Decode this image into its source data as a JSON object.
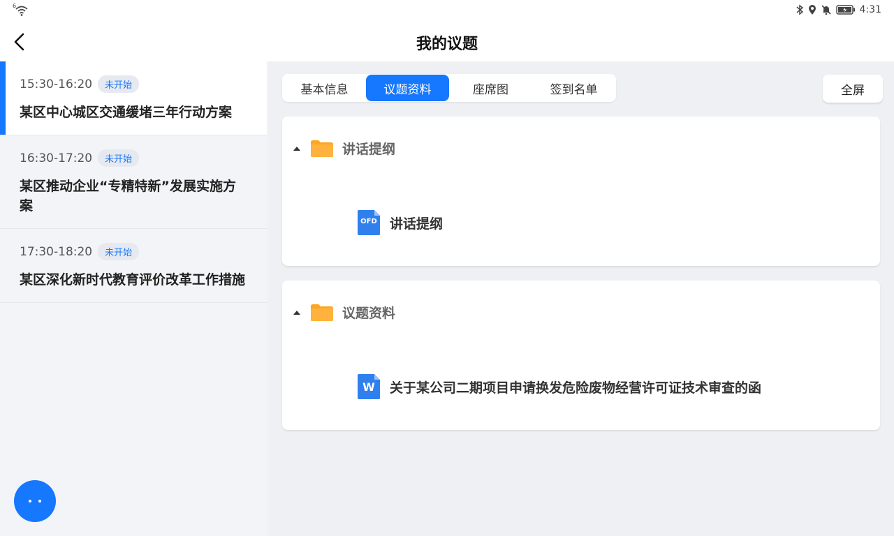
{
  "status_bar": {
    "wifi_superscript": "6",
    "time": "4:31",
    "icons": [
      "wifi-icon",
      "bluetooth-icon",
      "location-icon",
      "mute-icon",
      "battery-icon"
    ]
  },
  "header": {
    "title": "我的议题"
  },
  "sidebar": {
    "items": [
      {
        "time": "15:30-16:20",
        "status": "未开始",
        "title": "某区中心城区交通缓堵三年行动方案"
      },
      {
        "time": "16:30-17:20",
        "status": "未开始",
        "title": "某区推动企业“专精特新”发展实施方案"
      },
      {
        "time": "17:30-18:20",
        "status": "未开始",
        "title": "某区深化新时代教育评价改革工作措施"
      }
    ]
  },
  "tabs": [
    {
      "label": "基本信息"
    },
    {
      "label": "议题资料"
    },
    {
      "label": "座席图"
    },
    {
      "label": "签到名单"
    }
  ],
  "fullscreen_label": "全屏",
  "folders": [
    {
      "name": "讲话提纲",
      "files": [
        {
          "type_label": "OFD",
          "name": "讲话提纲"
        }
      ]
    },
    {
      "name": "议题资料",
      "files": [
        {
          "type_label": "W",
          "name": "关于某公司二期项目申请换发危险废物经营许可证技术审查的函"
        }
      ]
    }
  ],
  "colors": {
    "accent": "#1677ff",
    "folder": "#ffa51f",
    "file_icon": "#2f80ed"
  }
}
